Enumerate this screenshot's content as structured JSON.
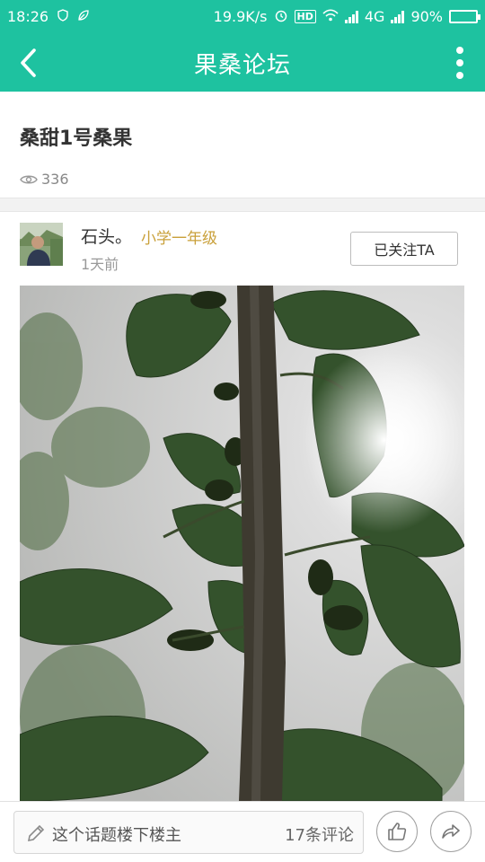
{
  "status_bar": {
    "time": "18:26",
    "speed": "19.9K/s",
    "hd": "HD",
    "network": "4G",
    "battery": "90%",
    "battery_level": 0.9,
    "icons": [
      "shield-icon",
      "leaf-icon",
      "alarm-icon",
      "wifi-icon",
      "signal-icon",
      "battery-icon"
    ]
  },
  "app_bar": {
    "title": "果桑论坛",
    "back_icon": "chevron-left-icon",
    "more_icon": "more-vertical-icon"
  },
  "post": {
    "title": "桑甜1号桑果",
    "views": "336"
  },
  "author": {
    "name": "石头。",
    "level": "小学一年级",
    "time": "1天前",
    "follow_label": "已关注TA"
  },
  "bottom_bar": {
    "placeholder": "这个话题楼下楼主",
    "comment_count": "17条评论",
    "like_icon": "thumbs-up-icon",
    "share_icon": "share-icon"
  },
  "colors": {
    "brand": "#1ec2a0",
    "level": "#c9a03a"
  }
}
